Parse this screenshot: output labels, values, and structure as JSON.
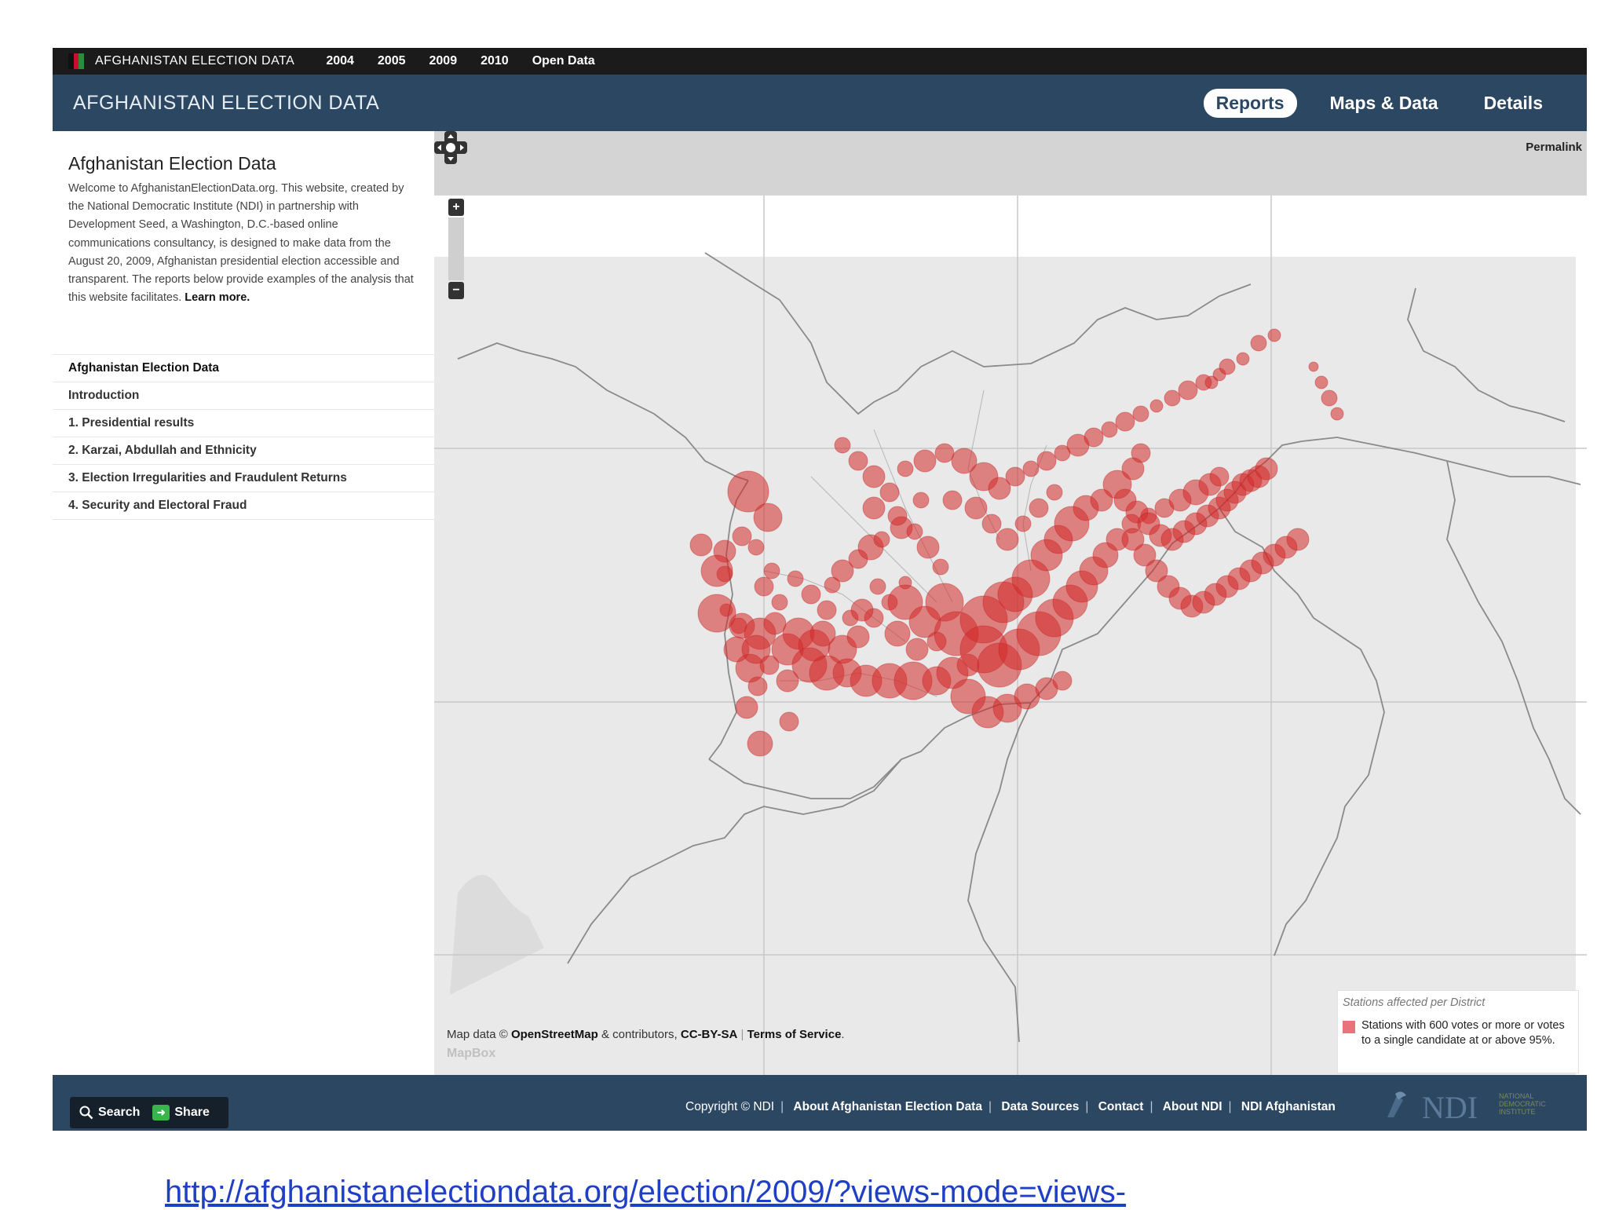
{
  "topbar": {
    "brand": "AFGHANISTAN ELECTION DATA",
    "years": [
      "2004",
      "2005",
      "2009",
      "2010"
    ],
    "open_data": "Open Data"
  },
  "header": {
    "title": "AFGHANISTAN ELECTION DATA",
    "nav": [
      "Reports",
      "Maps & Data",
      "Details"
    ],
    "active_nav": "Reports"
  },
  "sidebar": {
    "title": "Afghanistan Election Data",
    "intro": "Welcome to AfghanistanElectionData.org. This website, created by the National Democratic Institute (NDI) in partnership with Development Seed, a Washington, D.C.-based online communications consultancy, is designed to make data from the August 20, 2009, Afghanistan presidential election accessible and transparent. The reports below provide examples of the analysis that this website facilitates.",
    "learn_more": "Learn more.",
    "toc": [
      "Afghanistan Election Data",
      "Introduction",
      "1. Presidential results",
      "2. Karzai, Abdullah and Ethnicity",
      "3. Election Irregularities and Fraudulent Returns",
      "4. Security and Electoral Fraud"
    ]
  },
  "map": {
    "permalink": "Permalink",
    "zoom_in": "+",
    "zoom_out": "−",
    "attribution": {
      "prefix": "Map data ©",
      "osm": "OpenStreetMap",
      "contributors": "& contributors,",
      "license": "CC-BY-SA",
      "sep": "|",
      "terms": "Terms of Service",
      "period": "."
    },
    "mapbox": "MapBox",
    "legend": {
      "title": "Stations affected per District",
      "item": "Stations with 600 votes or more or votes to a single candidate at or above 95%.",
      "color": "#e8737b"
    },
    "marker_color": "#d42a2a"
  },
  "footer": {
    "search": "Search",
    "share": "Share",
    "copyright": "Copyright © NDI",
    "links": [
      "About Afghanistan Election Data",
      "Data Sources",
      "Contact",
      "About NDI",
      "NDI Afghanistan"
    ],
    "logo_text": "NDI",
    "logo_sub": "NATIONAL DEMOCRATIC INSTITUTE"
  },
  "url": "http://afghanistanelectiondata.org/election/2009/?views-mode=views-"
}
